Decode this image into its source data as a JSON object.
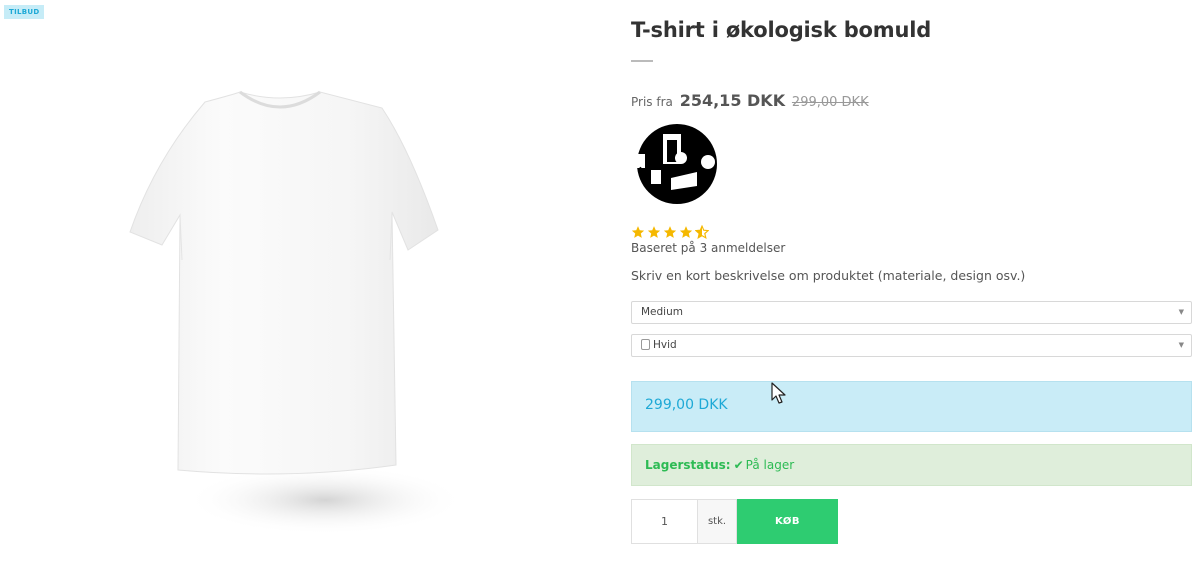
{
  "badge": "TILBUD",
  "product": {
    "title": "T-shirt i økologisk bomuld",
    "price_prefix": "Pris fra",
    "price_current": "254,15 DKK",
    "price_old": "299,00 DKK",
    "rating": 4.5,
    "rating_max": 5,
    "reviews_text": "Baseret på 3 anmeldelser",
    "description": "Skriv en kort beskrivelse om produktet (materiale, design osv.)"
  },
  "options": {
    "size_selected": "Medium",
    "color_selected": "Hvid"
  },
  "price_box": "299,00 DKK",
  "stock": {
    "label": "Lagerstatus:",
    "value": "På lager"
  },
  "cart": {
    "quantity": "1",
    "unit": "stk.",
    "buy_label": "KØB"
  },
  "colors": {
    "accent_blue": "#1ea9d6",
    "price_box_bg": "#c9ecf7",
    "stock_green": "#2dbb54",
    "stock_bg": "#dfeedb",
    "buy_button": "#2ecc71",
    "star": "#f5b800"
  }
}
